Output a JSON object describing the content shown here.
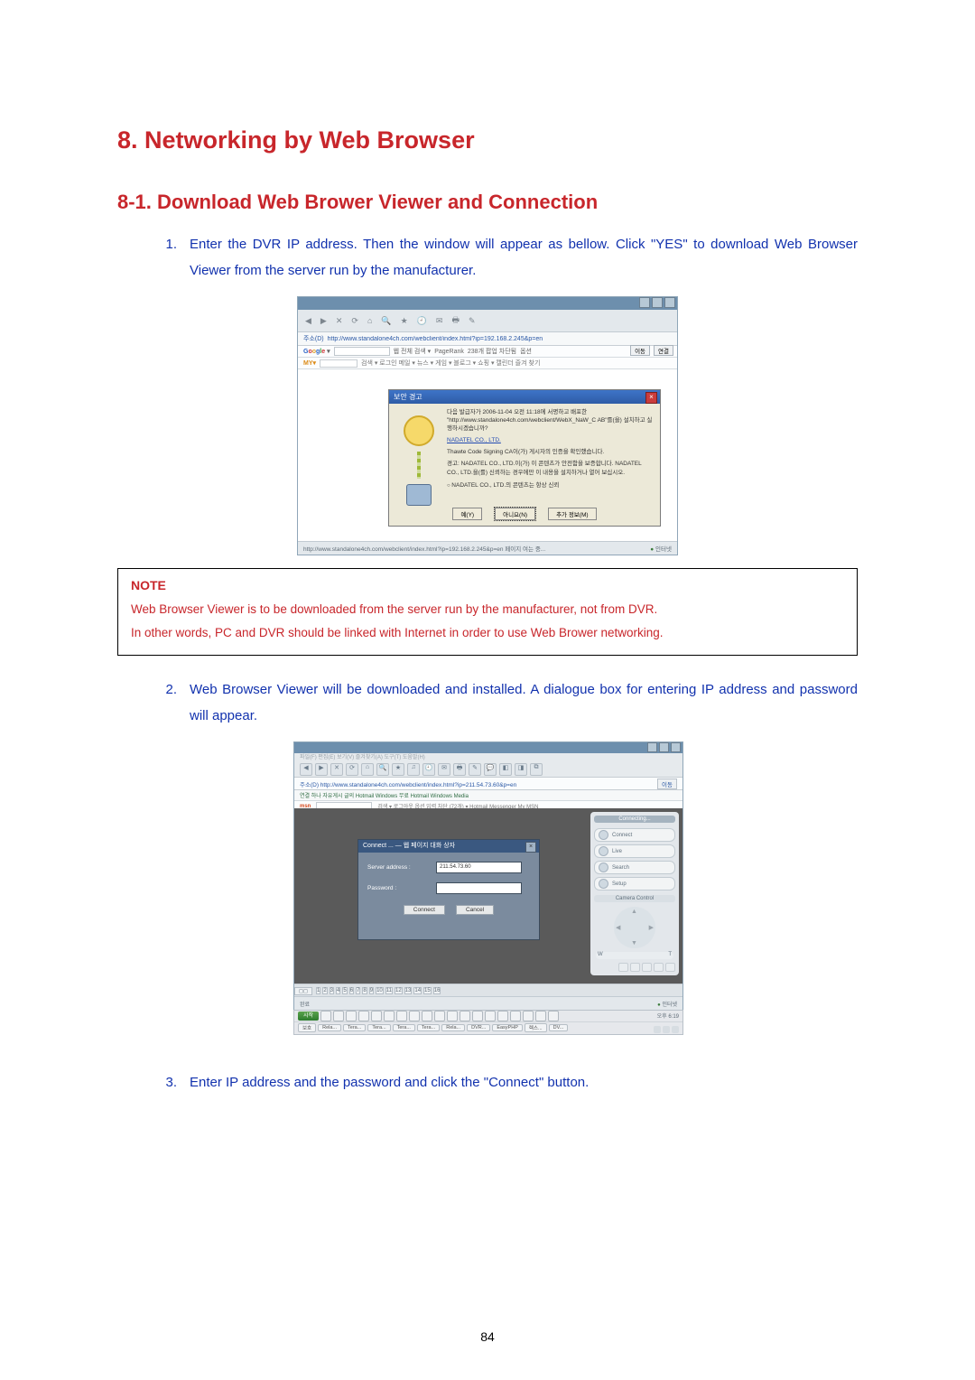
{
  "page_number": "84",
  "headings": {
    "h1": "8. Networking by Web Browser",
    "h2": "8-1. Download Web Brower Viewer and Connection"
  },
  "steps": {
    "s1_num": "1.",
    "s1_text": "Enter the DVR IP address. Then the window will appear as bellow. Click \"YES\" to download Web Browser Viewer from the server run by the manufacturer.",
    "s2_num": "2.",
    "s2_text": "Web Browser Viewer will be downloaded and installed. A dialogue box for entering IP address and password will appear.",
    "s3_num": "3.",
    "s3_text": "Enter IP address and the password and click the \"Connect\" button."
  },
  "note": {
    "title": "NOTE",
    "line1": "Web Browser Viewer is to be downloaded from the server run by the manufacturer, not from DVR.",
    "line2": "In other words, PC and DVR should be linked with Internet in order to use Web Brower networking."
  },
  "shot_a": {
    "addr_label": "주소(D)",
    "addr_url": "http://www.standalone4ch.com/webclient/index.html?ip=192.168.2.245&p=en",
    "addr_go": "이동",
    "addr_link": "연결",
    "gbar_label": "Google ▾",
    "gbar_field": "웹 전체 검색 ▾",
    "gbar_pr": "PageRank",
    "gbar_block": "238개 팝업 차단됨",
    "gbar_opt": "옵션",
    "ybar_logo": "MY▾",
    "ybar_items": "검색 ▾  로그인  메일 ▾  뉴스 ▾  게임 ▾  블로그 ▾  쇼핑 ▾  캘린더  즐겨 찾기",
    "dialog_title": "보안 경고",
    "dt1": "다음 발급자가 2006-11-04 오전 11:18에 서명하고 배포한 \"http://www.standalone4ch.com/webclient/WebX_NaW_C AB\"를(을) 설치하고 실행하시겠습니까?",
    "dt_link": "NADATEL CO., LTD.",
    "dt2": "Thawte Code Signing CA이(가) 게시자의 인증을 확인했습니다.",
    "dt3": "경고: NADATEL CO., LTD.이(가) 이 콘텐츠가 안전함을 보증합니다. NADATEL CO., LTD.을(를) 신뢰하는 경우에만 이 내용을 설치하거나 열어 보십시오.",
    "dt_radio": "NADATEL CO., LTD.의 콘텐츠는 항상 신뢰",
    "btn_yes": "예(Y)",
    "btn_no": "아니요(N)",
    "btn_info": "추가 정보(M)",
    "status_left": "http://www.standalone4ch.com/webclient/index.html?ip=192.168.2.245&p=en 페이지 여는 중...",
    "status_right": "인터넷"
  },
  "shot_b": {
    "menubar": "파일(F)  편집(E)  보기(V)  즐겨찾기(A)  도구(T)  도움말(H)",
    "addr_label": "주소(D)",
    "addr_url": "http://www.standalone4ch.com/webclient/index.html?ip=211.54.73.60&p=en",
    "addr_go": "이동",
    "linkbar": "연결   하나 자유게시 글의   Hotmail   Windows   무료 Hotmail   Windows Media",
    "msnbar": "검색 ▾   로그아웃   옵션   입력 차단 (72개) ▾   Hotmail   Messenger   My MSN",
    "msn_logo": "msn",
    "conn_title": "Connect ... — 웹 페이지 대화 상자",
    "conn_server_lbl": "Server address  :",
    "conn_server_val": "211.54.73.60",
    "conn_pw_lbl": "Password  :",
    "conn_btn_connect": "Connect",
    "conn_btn_cancel": "Cancel",
    "side_connecting": "Connecting...",
    "side_connect": "Connect",
    "side_live": "Live",
    "side_search": "Search",
    "side_setup": "Setup",
    "side_cc": "Camera Control",
    "status_done": "완료",
    "status_net": "인터넷",
    "ch_nums": [
      "1",
      "2",
      "3",
      "4",
      "5",
      "6",
      "7",
      "8",
      "9",
      "10",
      "11",
      "12",
      "13",
      "14",
      "15",
      "16"
    ],
    "task_start": "시작",
    "task_items": [
      "보호",
      "Rela...",
      "Tera...",
      "Tera...",
      "Tera...",
      "Tera...",
      "Rela...",
      "DVR...",
      "EasyPHP",
      "렉스...",
      "DV..."
    ],
    "clock": "오후 6:19"
  }
}
